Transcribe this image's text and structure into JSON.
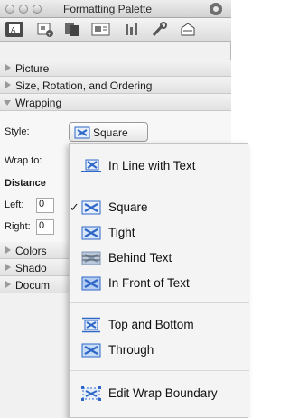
{
  "window": {
    "title": "Formatting Palette"
  },
  "toolbar": {
    "icons": [
      "text-box-icon",
      "insert-object-icon",
      "copy-icon",
      "picture-icon",
      "chart-icon",
      "tools-icon",
      "document-icon"
    ]
  },
  "sections": {
    "picture": "Picture",
    "size": "Size, Rotation, and Ordering",
    "wrapping": "Wrapping",
    "colors": "Colors",
    "shadow": "Shado",
    "document": "Docum"
  },
  "wrapping_panel": {
    "style_label": "Style:",
    "style_value": "Square",
    "wrap_to_label": "Wrap to:",
    "distance_label": "Distance",
    "left_label": "Left:",
    "left_value": "0",
    "right_label": "Right:",
    "right_value": "0"
  },
  "menu": {
    "items": [
      {
        "label": "In Line with Text",
        "checked": false
      },
      {
        "label": "Square",
        "checked": true
      },
      {
        "label": "Tight",
        "checked": false
      },
      {
        "label": "Behind Text",
        "checked": false
      },
      {
        "label": "In Front of Text",
        "checked": false
      },
      {
        "label": "Top and Bottom",
        "checked": false
      },
      {
        "label": "Through",
        "checked": false
      },
      {
        "label": "Edit Wrap Boundary",
        "checked": false
      }
    ],
    "check_glyph": "✓"
  },
  "colors": {
    "accent_blue": "#2f67c8",
    "palette_bg": "#f1f1f1"
  }
}
